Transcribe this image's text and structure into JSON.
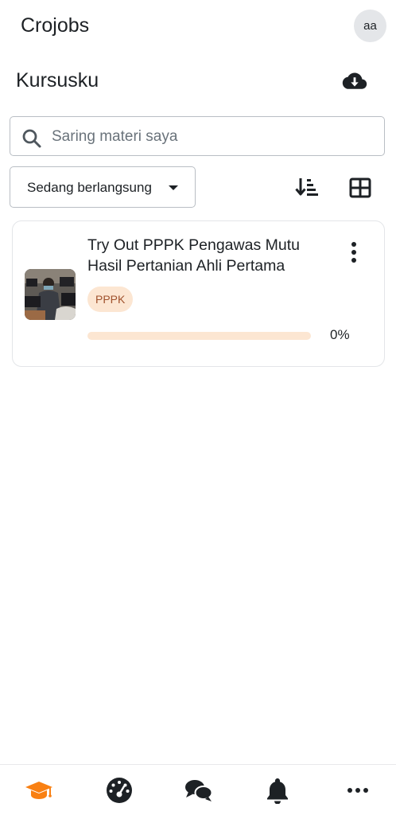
{
  "app": {
    "title": "Crojobs",
    "avatar_initials": "aa"
  },
  "page": {
    "title": "Kursusku"
  },
  "search": {
    "placeholder": "Saring materi saya"
  },
  "filter": {
    "selected": "Sedang berlangsung"
  },
  "course": {
    "title": "Try Out PPPK Pengawas Mutu Hasil Pertanian Ahli Pertama",
    "tag": "PPPK",
    "progress_text": "0%",
    "progress_fraction": 0
  },
  "colors": {
    "accent": "#f98012",
    "tag_bg": "#fce6d2",
    "tag_text": "#a0522d"
  },
  "icons": {
    "download": "cloud-download-icon",
    "search": "search-icon",
    "sort": "sort-icon",
    "grid": "grid-view-icon",
    "more": "more-vertical-icon",
    "nav": [
      "graduation-cap-icon",
      "dashboard-icon",
      "messages-icon",
      "bell-icon",
      "more-horizontal-icon"
    ]
  }
}
